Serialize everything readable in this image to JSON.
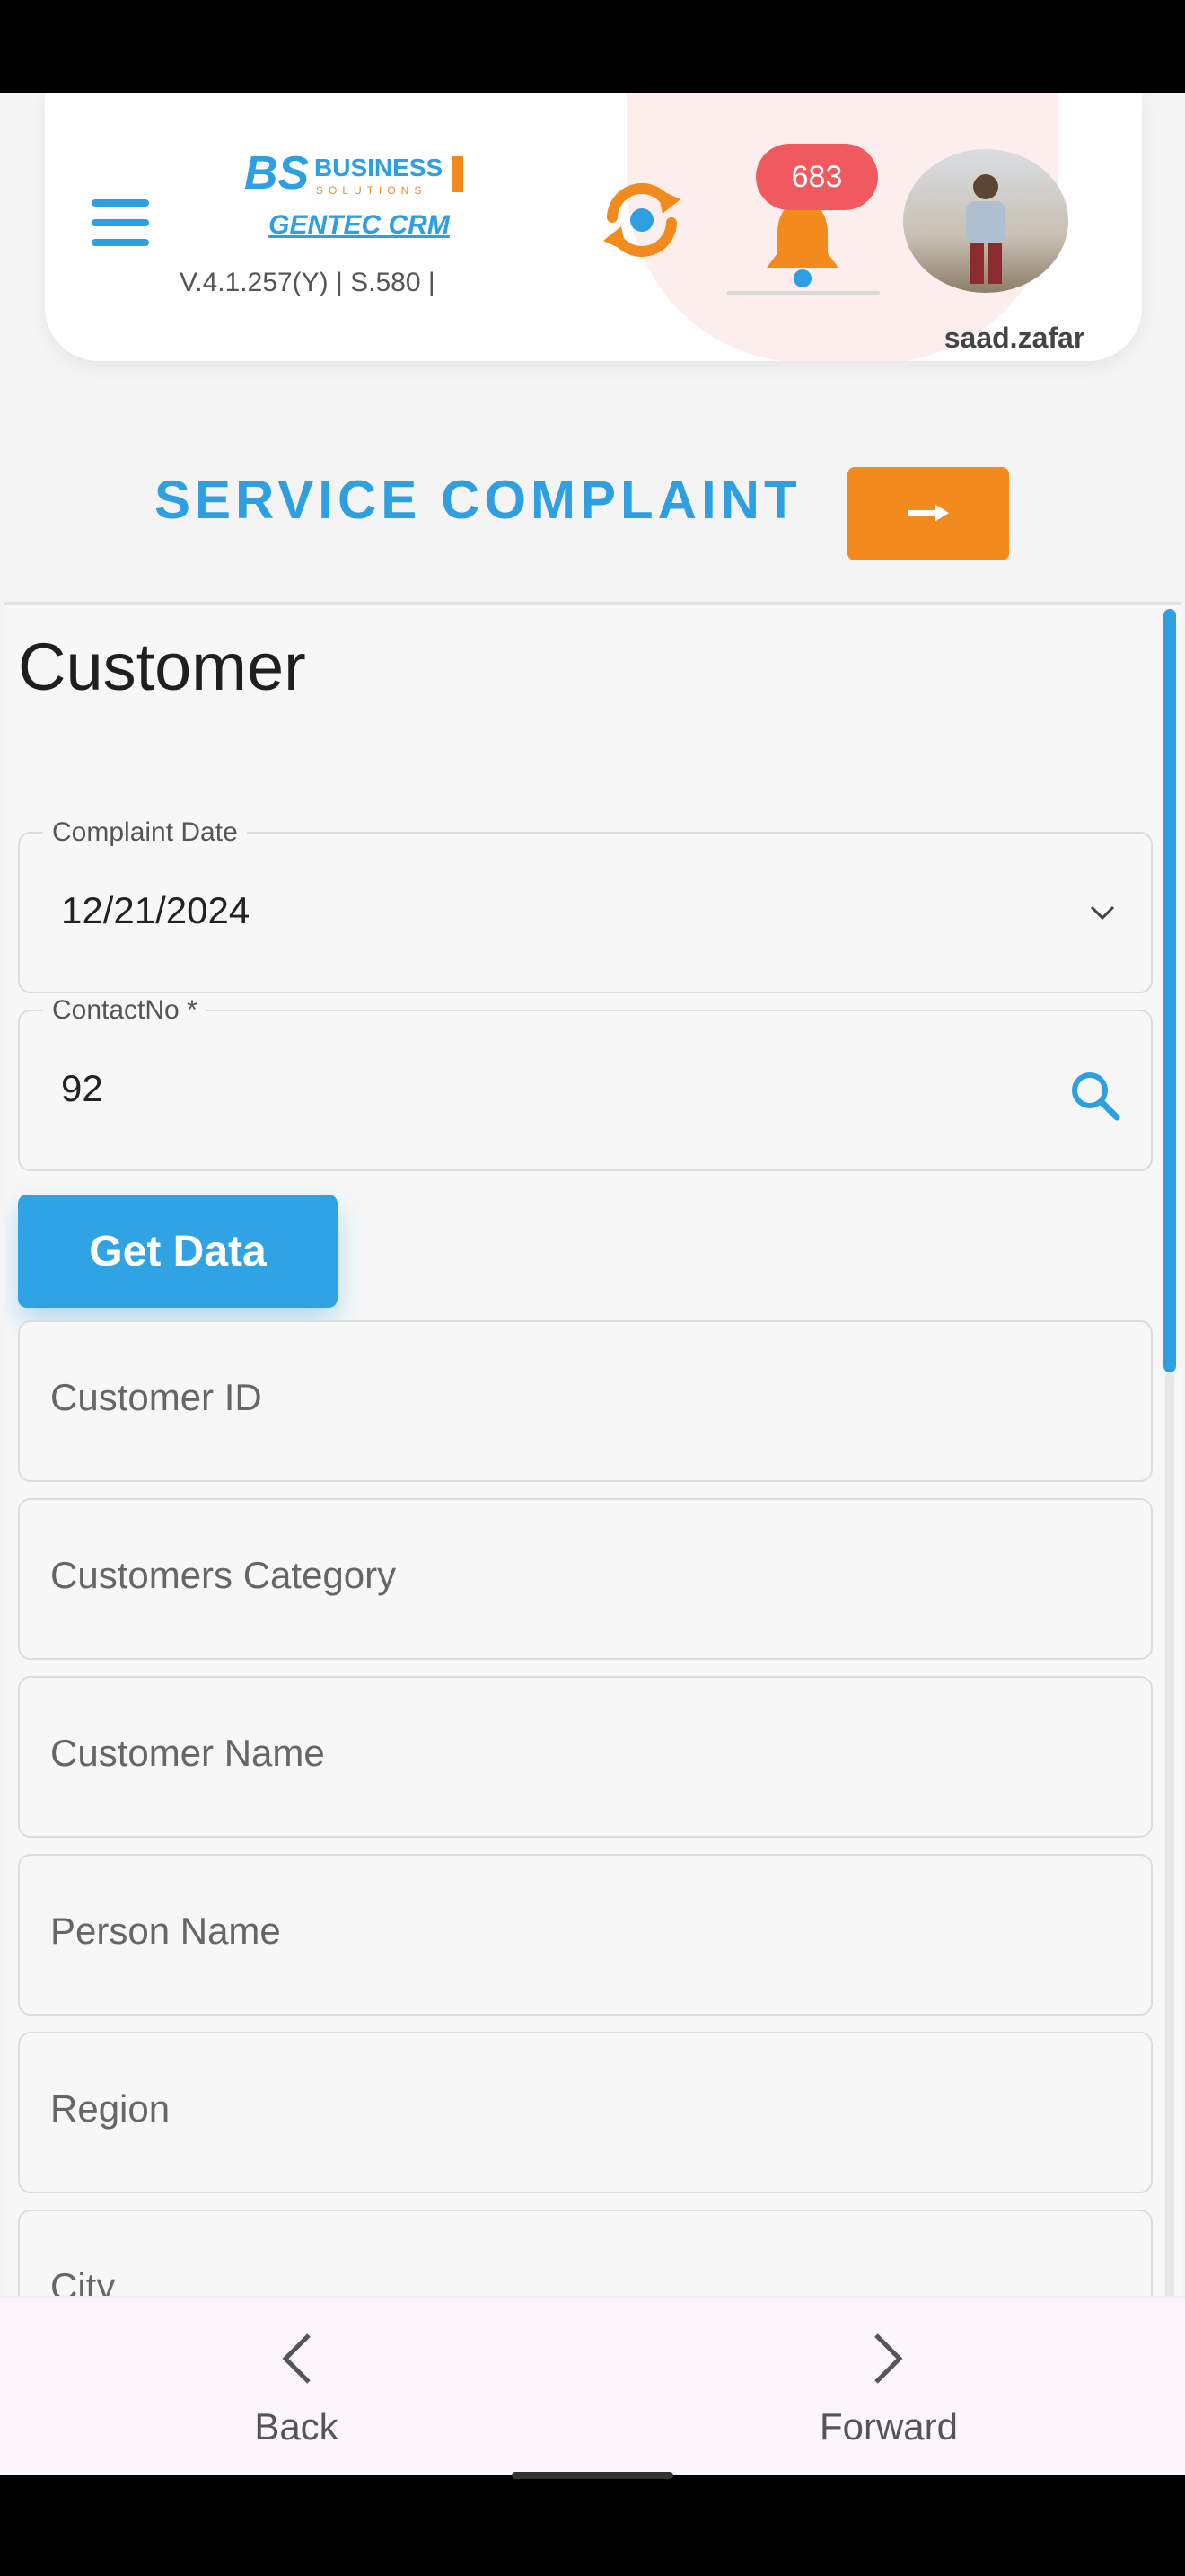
{
  "header": {
    "logo_text": "BUSINESS SOLUTIONS",
    "app_name": "GENTEC CRM",
    "version": "V.4.1.257(Y) | S.580 |",
    "notification_count": "683",
    "username": "saad.zafar",
    "icons": [
      "menu-icon",
      "sync-icon",
      "bell-icon"
    ]
  },
  "page": {
    "title": "SERVICE COMPLAINT",
    "arrow_icon": "arrow-right-icon"
  },
  "form": {
    "section_title": "Customer",
    "complaint_date": {
      "label": "Complaint Date",
      "value": "12/21/2024"
    },
    "contact_no": {
      "label": "ContactNo *",
      "value": "92"
    },
    "get_data_label": "Get Data",
    "fields": [
      "Customer ID",
      "Customers Category",
      "Customer Name",
      "Person Name",
      "Region",
      "City"
    ]
  },
  "bottom_nav": {
    "back_label": "Back",
    "forward_label": "Forward"
  },
  "colors": {
    "accent": "#2e9fe0",
    "orange": "#f28a1d",
    "badge": "#f0595e"
  }
}
